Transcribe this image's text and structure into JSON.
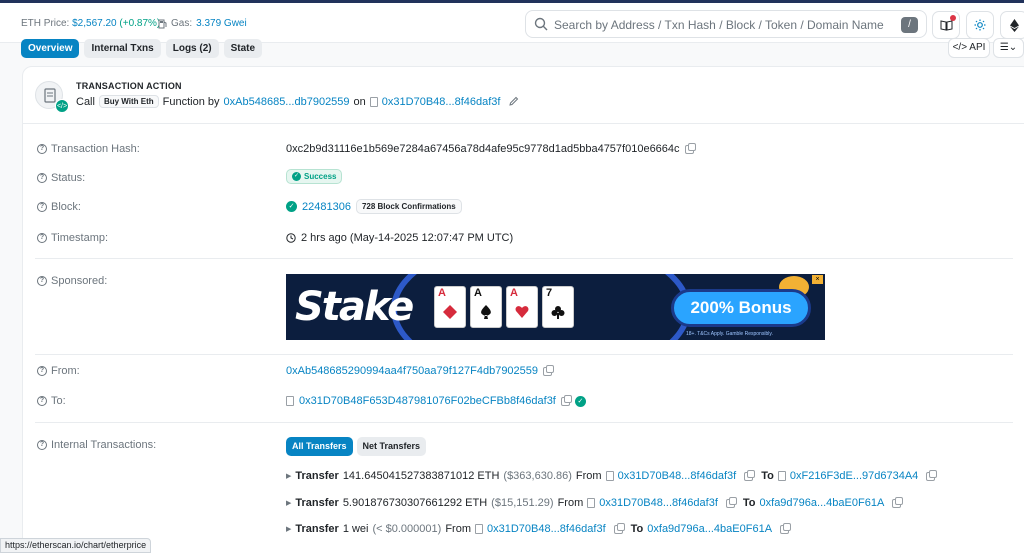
{
  "header": {
    "eth_price_label": "ETH Price:",
    "eth_price_value": "$2,567.20",
    "eth_price_change": "(+0.87%)",
    "gas_label": "Gas:",
    "gas_value": "3.379 Gwei",
    "search_placeholder": "Search by Address / Txn Hash / Block / Token / Domain Name",
    "search_shortcut": "/"
  },
  "tabs": [
    {
      "label": "Overview",
      "active": true
    },
    {
      "label": "Internal Txns",
      "active": false
    },
    {
      "label": "Logs (2)",
      "active": false
    },
    {
      "label": "State",
      "active": false
    }
  ],
  "toolbar": {
    "api_label": "API"
  },
  "tx_action": {
    "title": "TRANSACTION ACTION",
    "call": "Call",
    "method": "Buy With Eth",
    "function_by": "Function by",
    "from_addr": "0xAb548685...db7902559",
    "on": "on",
    "to_addr": "0x31D70B48...8f46daf3f"
  },
  "rows": {
    "hash_label": "Transaction Hash:",
    "hash_value": "0xc2b9d31116e1b569e7284a67456a78d4afe95c9778d1ad5bba4757f010e6664c",
    "status_label": "Status:",
    "status_value": "Success",
    "block_label": "Block:",
    "block_value": "22481306",
    "block_confirmations": "728 Block Confirmations",
    "timestamp_label": "Timestamp:",
    "timestamp_value": "2 hrs ago (May-14-2025 12:07:47 PM UTC)",
    "sponsored_label": "Sponsored:",
    "from_label": "From:",
    "from_value": "0xAb548685290994aa4f750aa79f127F4db7902559",
    "to_label": "To:",
    "to_value": "0x31D70B48F653D487981076F02beCFBb8f46daf3f",
    "internal_label": "Internal Transactions:"
  },
  "ad": {
    "brand": "Stake",
    "bonus": "200% Bonus",
    "fineprint": "18+. T&Cs Apply. Gamble Responsibly.",
    "cards": [
      "A",
      "A",
      "A",
      "7"
    ]
  },
  "transfer_tabs": {
    "all": "All Transfers",
    "net": "Net Transfers"
  },
  "transfers": [
    {
      "label": "Transfer",
      "amount": "141.645041527383871012 ETH",
      "fiat": "($363,630.86)",
      "from_label": "From",
      "from": "0x31D70B48...8f46daf3f",
      "to_label": "To",
      "to": "0xF216F3dE...97d6734A4"
    },
    {
      "label": "Transfer",
      "amount": "5.901876730307661292 ETH",
      "fiat": "($15,151.29)",
      "from_label": "From",
      "from": "0x31D70B48...8f46daf3f",
      "to_label": "To",
      "to": "0xfa9d796a...4baE0F61A"
    },
    {
      "label": "Transfer",
      "amount": "1 wei",
      "fiat": "(< $0.000001)",
      "from_label": "From",
      "from": "0x31D70B48...8f46daf3f",
      "to_label": "To",
      "to": "0xfa9d796a...4baE0F61A"
    }
  ],
  "status_url": "https://etherscan.io/chart/etherprice",
  "colors": {
    "link": "#0784c3",
    "success": "#00a186",
    "navy": "#21325b"
  }
}
